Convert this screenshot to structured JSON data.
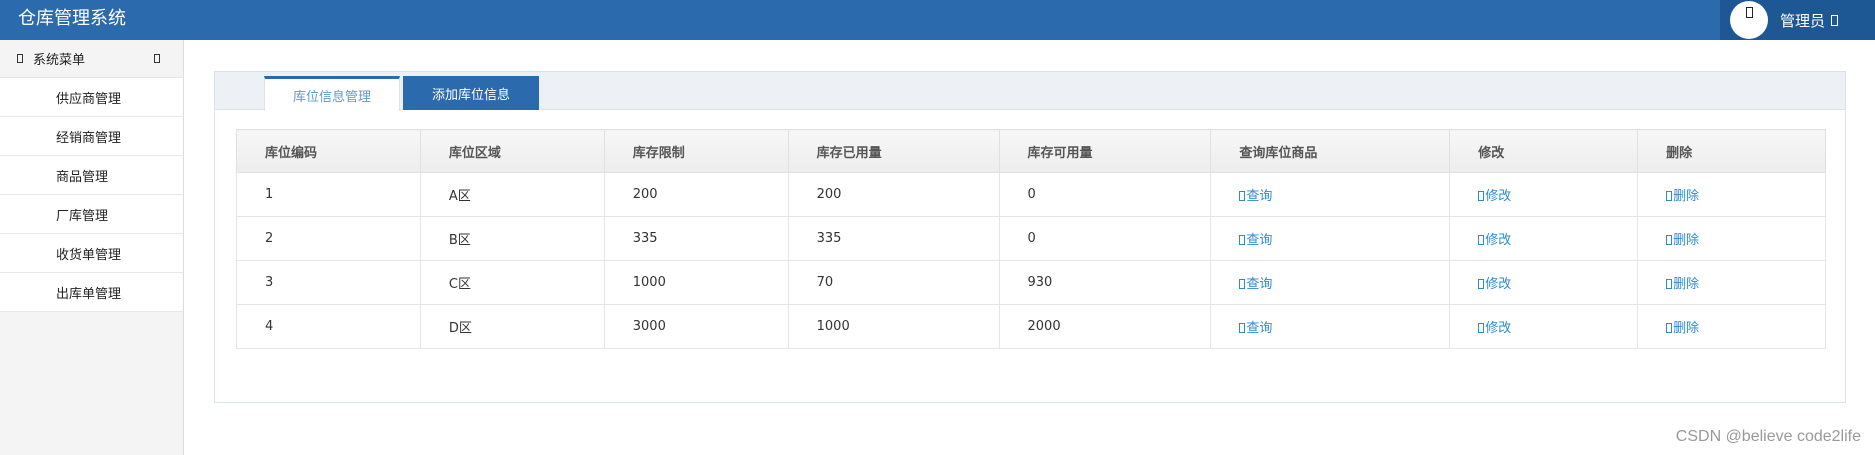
{
  "app": {
    "title": "仓库管理系统"
  },
  "user": {
    "name": "管理员"
  },
  "sidebar": {
    "header": "系统菜单",
    "items": [
      {
        "label": "供应商管理"
      },
      {
        "label": "经销商管理"
      },
      {
        "label": "商品管理"
      },
      {
        "label": "厂库管理"
      },
      {
        "label": "收货单管理"
      },
      {
        "label": "出库单管理"
      }
    ]
  },
  "tabs": [
    {
      "label": "库位信息管理"
    },
    {
      "label": "添加库位信息"
    }
  ],
  "table": {
    "headers": [
      "库位编码",
      "库位区域",
      "库存限制",
      "库存已用量",
      "库存可用量",
      "查询库位商品",
      "修改",
      "删除"
    ],
    "actions": {
      "query": "查询",
      "edit": "修改",
      "delete": "删除"
    },
    "rows": [
      {
        "code": "1",
        "area": "A区",
        "limit": "200",
        "used": "200",
        "available": "0"
      },
      {
        "code": "2",
        "area": "B区",
        "limit": "335",
        "used": "335",
        "available": "0"
      },
      {
        "code": "3",
        "area": "C区",
        "limit": "1000",
        "used": "70",
        "available": "930"
      },
      {
        "code": "4",
        "area": "D区",
        "limit": "3000",
        "used": "1000",
        "available": "2000"
      }
    ]
  },
  "watermark": "CSDN @believe code2life",
  "colors": {
    "header": "#2a6aad",
    "header_dark": "#1d5894",
    "link": "#2d8bd4"
  },
  "icons": {
    "avatar": "user-icon",
    "caret": "caret-icon",
    "menu": "menu-icon",
    "collapse": "collapse-icon",
    "action": "action-icon"
  }
}
